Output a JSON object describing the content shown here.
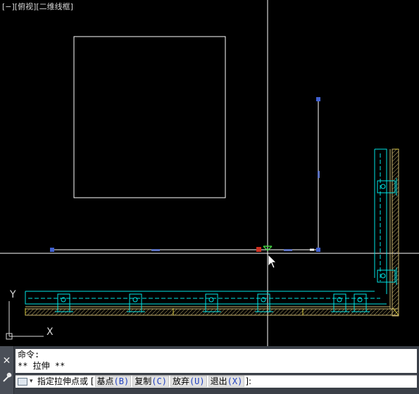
{
  "viewport": {
    "view_label": "[−][俯视][二维线框]",
    "ucs": {
      "y_label": "Y",
      "x_label": "X"
    },
    "colors": {
      "background": "#000000",
      "geometry": "#ffffff",
      "wall": "#00e5e5",
      "hatch": "#c8b46e",
      "grip": "#4060d0",
      "crosshair": "#ffffff"
    }
  },
  "command": {
    "history": [
      "命令:",
      "** 拉伸 **"
    ],
    "prompt": "指定拉伸点或",
    "options": [
      {
        "label": "基点",
        "key": "(B)"
      },
      {
        "label": "复制",
        "key": "(C)"
      },
      {
        "label": "放弃",
        "key": "(U)"
      },
      {
        "label": "退出",
        "key": "(X)"
      }
    ],
    "bracket_open": "[",
    "bracket_close": "]:"
  }
}
